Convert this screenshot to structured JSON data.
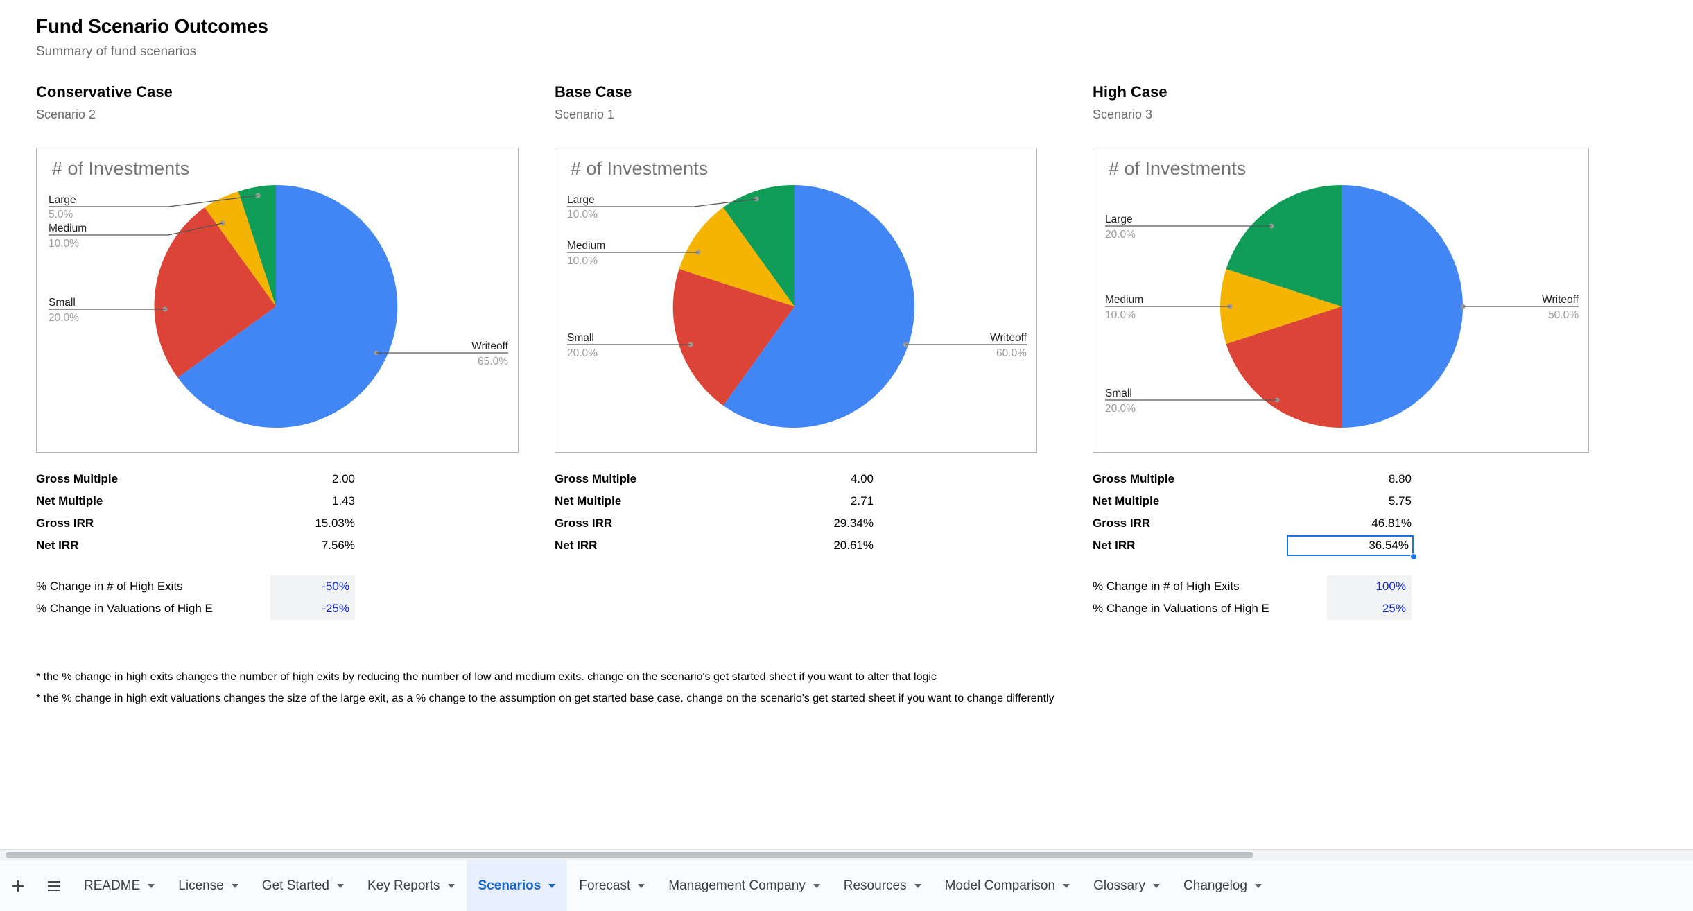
{
  "header": {
    "title": "Fund Scenario Outcomes",
    "subtitle": "Summary of fund scenarios"
  },
  "columns": [
    {
      "case_title": "Conservative Case",
      "case_sub": "Scenario 2",
      "chart_heading": "# of Investments",
      "metrics": [
        {
          "label": "Gross Multiple",
          "value": "2.00"
        },
        {
          "label": "Net Multiple",
          "value": "1.43"
        },
        {
          "label": "Gross IRR",
          "value": "15.03%"
        },
        {
          "label": "Net IRR",
          "value": "7.56%"
        }
      ],
      "assumptions": [
        {
          "label": "% Change in # of High Exits",
          "value": "-50%"
        },
        {
          "label": "% Change in Valuations of High E",
          "value": "-25%"
        }
      ]
    },
    {
      "case_title": "Base Case",
      "case_sub": "Scenario 1",
      "chart_heading": "# of Investments",
      "metrics": [
        {
          "label": "Gross Multiple",
          "value": "4.00"
        },
        {
          "label": "Net Multiple",
          "value": "2.71"
        },
        {
          "label": "Gross IRR",
          "value": "29.34%"
        },
        {
          "label": "Net IRR",
          "value": "20.61%"
        }
      ],
      "assumptions": []
    },
    {
      "case_title": "High Case",
      "case_sub": "Scenario 3",
      "chart_heading": "# of Investments",
      "metrics": [
        {
          "label": "Gross Multiple",
          "value": "8.80"
        },
        {
          "label": "Net Multiple",
          "value": "5.75"
        },
        {
          "label": "Gross IRR",
          "value": "46.81%"
        },
        {
          "label": "Net IRR",
          "value": "36.54%"
        }
      ],
      "assumptions": [
        {
          "label": "% Change in # of High Exits",
          "value": "100%"
        },
        {
          "label": "% Change in Valuations of High E",
          "value": "25%"
        }
      ]
    }
  ],
  "selected_cell": {
    "column_index": 2,
    "metric_index": 3,
    "value": "36.54%"
  },
  "footnotes": [
    "* the % change in high exits changes the number of high exits by reducing the number of low and medium exits. change on the scenario's get started sheet if you want to alter that logic",
    "* the % change in high exit valuations changes the size of the large exit, as a % change to the assumption on get started base case. change on the scenario's get started sheet if you want to change differently"
  ],
  "chart_data": [
    {
      "type": "pie",
      "title": "# of Investments",
      "chart_title": "Conservative Case",
      "categories": [
        "Writeoff",
        "Small",
        "Medium",
        "Large"
      ],
      "values": [
        65.0,
        20.0,
        10.0,
        5.0
      ],
      "labels": [
        "65.0%",
        "20.0%",
        "10.0%",
        "5.0%"
      ],
      "colors": [
        "#4285f4",
        "#db4437",
        "#f4b400",
        "#0f9d58"
      ],
      "legend": "none",
      "grid": false
    },
    {
      "type": "pie",
      "title": "# of Investments",
      "chart_title": "Base Case",
      "categories": [
        "Writeoff",
        "Small",
        "Medium",
        "Large"
      ],
      "values": [
        60.0,
        20.0,
        10.0,
        10.0
      ],
      "labels": [
        "60.0%",
        "20.0%",
        "10.0%",
        "10.0%"
      ],
      "colors": [
        "#4285f4",
        "#db4437",
        "#f4b400",
        "#0f9d58"
      ],
      "legend": "none",
      "grid": false
    },
    {
      "type": "pie",
      "title": "# of Investments",
      "chart_title": "High Case",
      "categories": [
        "Writeoff",
        "Small",
        "Medium",
        "Large"
      ],
      "values": [
        50.0,
        20.0,
        10.0,
        20.0
      ],
      "labels": [
        "50.0%",
        "20.0%",
        "10.0%",
        "20.0%"
      ],
      "colors": [
        "#4285f4",
        "#db4437",
        "#f4b400",
        "#0f9d58"
      ],
      "legend": "none",
      "grid": false
    }
  ],
  "tabbar": {
    "add_label": "+",
    "menu_label": "All sheets",
    "tabs": [
      {
        "label": "README",
        "active": false
      },
      {
        "label": "License",
        "active": false
      },
      {
        "label": "Get Started",
        "active": false
      },
      {
        "label": "Key Reports",
        "active": false
      },
      {
        "label": "Scenarios",
        "active": true
      },
      {
        "label": "Forecast",
        "active": false
      },
      {
        "label": "Management Company",
        "active": false
      },
      {
        "label": "Resources",
        "active": false
      },
      {
        "label": "Model Comparison",
        "active": false
      },
      {
        "label": "Glossary",
        "active": false
      },
      {
        "label": "Changelog",
        "active": false
      }
    ]
  },
  "colors": {
    "accent": "#1a73e8",
    "assumption_text": "#1229d6",
    "pie_blue": "#4285f4",
    "pie_red": "#db4437",
    "pie_yellow": "#f4b400",
    "pie_green": "#0f9d58"
  }
}
